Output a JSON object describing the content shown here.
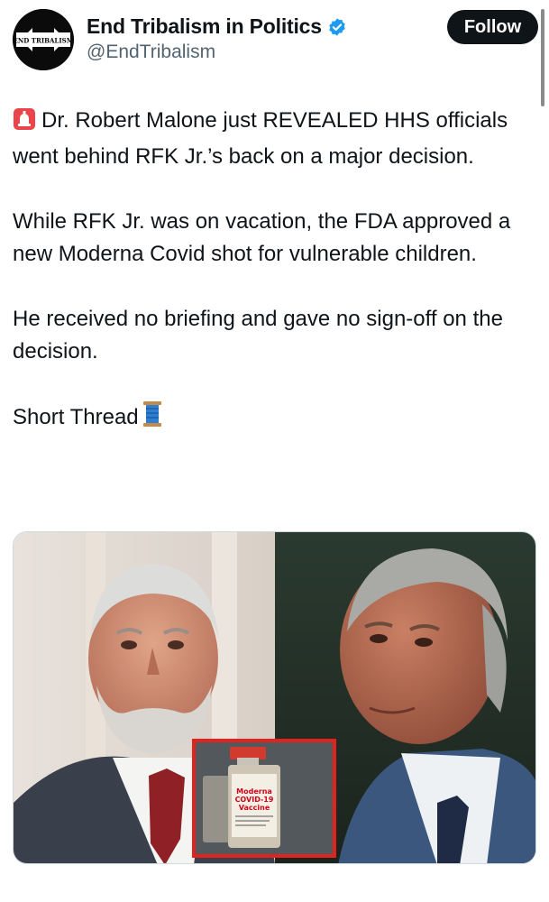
{
  "author": {
    "display_name": "End Tribalism in Politics",
    "handle": "@EndTribalism",
    "avatar_text": "END TRIBALISM"
  },
  "follow_label": "Follow",
  "tweet": {
    "paragraphs": [
      "Dr. Robert Malone just REVEALED HHS officials went behind RFK Jr.’s back on a major decision.",
      "While RFK Jr. was on vacation, the FDA approved a new Moderna Covid shot for vulnerable children.",
      "He received no briefing and gave no sign-off on the decision.",
      "Short Thread"
    ],
    "emoji_start": "siren-emoji",
    "emoji_end": "thread-spool-emoji"
  },
  "media": {
    "vial_label_lines": [
      "Moderna",
      "COVID-19",
      "Vaccine"
    ]
  },
  "colors": {
    "verified": "#1d9bf0",
    "follow_bg": "#0f1419",
    "handle": "#536471",
    "inset_border": "#e0231e"
  }
}
